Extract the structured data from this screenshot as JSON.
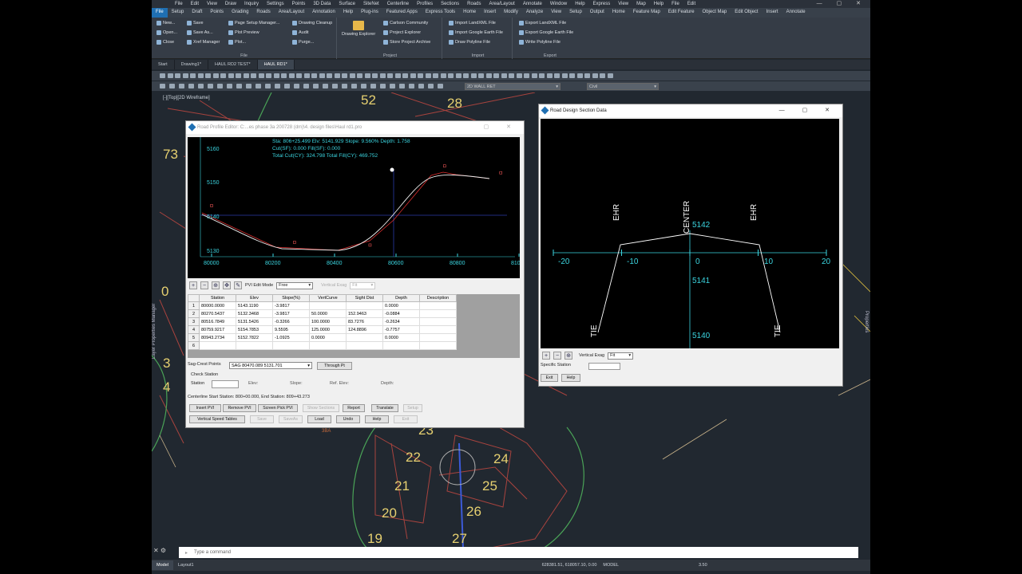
{
  "menu_top": [
    "File",
    "Edit",
    "View",
    "Draw",
    "Inquiry",
    "Settings",
    "Points",
    "3D Data",
    "Surface",
    "SiteNet",
    "Centerline",
    "Profiles",
    "Sections",
    "Roads",
    "Area/Layout",
    "Annotate",
    "Window",
    "Help",
    "Express",
    "View",
    "Map",
    "Help",
    "File",
    "Edit"
  ],
  "menu_tabs": [
    "File",
    "Setup",
    "Draft",
    "Points",
    "Grading",
    "Roads",
    "Area/Layout",
    "Annotation",
    "Help",
    "Plug-ins",
    "Featured Apps",
    "Express Tools",
    "Home",
    "Insert",
    "Modify",
    "Analyze",
    "View",
    "Setup",
    "Output",
    "Home",
    "Feature Map",
    "Edit Feature",
    "Object Map",
    "Edit Object",
    "Insert",
    "Annotate"
  ],
  "ribbon": {
    "file_items": [
      "New...",
      "Open...",
      "Close",
      "Save",
      "Save As...",
      "Xref Manager",
      "Page Setup Manager...",
      "Plot Preview",
      "Plot...",
      "Drawing Cleanup",
      "Audit",
      "Purge..."
    ],
    "file_title": "File",
    "project_items": [
      "Drawing Explorer",
      "Carlson Community",
      "Project Explorer",
      "Store Project Archive"
    ],
    "project_title": "Project",
    "import_items": [
      "Import LandXML File",
      "Import Google Earth File",
      "Draw Polyline File"
    ],
    "import_title": "Import",
    "export_items": [
      "Export LandXML File",
      "Export Google Earth File",
      "Write Polyline File"
    ],
    "export_title": "Export"
  },
  "doc_tabs": [
    "Start",
    "Drawing1*",
    "HAUL RD2 TEST*",
    "HAUL RD1*"
  ],
  "toolbar_fields": {
    "layer": "2D WALL RET",
    "style": "Civil"
  },
  "view_label": "[-][Top][2D Wireframe]",
  "lot_numbers": [
    {
      "n": "52"
    },
    {
      "n": "28"
    },
    {
      "n": "73"
    },
    {
      "n": "0"
    },
    {
      "n": "3"
    },
    {
      "n": "4"
    },
    {
      "n": "23"
    },
    {
      "n": "22"
    },
    {
      "n": "24"
    },
    {
      "n": "21"
    },
    {
      "n": "25"
    },
    {
      "n": "20"
    },
    {
      "n": "26"
    },
    {
      "n": "19"
    },
    {
      "n": "27"
    },
    {
      "n": "E"
    }
  ],
  "small_label": "3BA",
  "profile_editor": {
    "title": "Road Profile Editor: C:...es phase 3a 200728 (dm)\\4. design files\\Haul rd1.pro",
    "info_line1": "Sta: 806+25.499 Elv: 5141.929 Slope: 9.560% Depth: 1.758",
    "info_line2": "Cut(SF): 0.000 Fill(SF): 0.000",
    "info_line3": "Total Cut(CY): 324.798 Total Fill(CY): 469.752",
    "pvi_edit_mode_label": "PVI Edit Mode",
    "pvi_edit_mode": "Free",
    "vert_exag_label": "Vertical Exag",
    "vert_exag": "Fit",
    "columns": [
      "Station",
      "Elev",
      "Slope(%)",
      "VertCurve",
      "Sight Dist",
      "Depth",
      "Description"
    ],
    "rows": [
      {
        "n": "1",
        "station": "80000.0000",
        "elev": "5143.1190",
        "slope": "-3.9817",
        "vc": "",
        "sd": "",
        "depth": "0.0000",
        "desc": ""
      },
      {
        "n": "2",
        "station": "80270.5437",
        "elev": "5132.3468",
        "slope": "-3.9817",
        "vc": "50.0000",
        "sd": "152.9463",
        "depth": "-0.0884",
        "desc": ""
      },
      {
        "n": "3",
        "station": "80516.7849",
        "elev": "5131.5426",
        "slope": "-0.3266",
        "vc": "100.0000",
        "sd": "83.7276",
        "depth": "-0.2634",
        "desc": ""
      },
      {
        "n": "4",
        "station": "80759.9217",
        "elev": "5154.7853",
        "slope": "9.5595",
        "vc": "125.0000",
        "sd": "124.8896",
        "depth": "-0.7757",
        "desc": ""
      },
      {
        "n": "5",
        "station": "80943.2734",
        "elev": "5152.7822",
        "slope": "-1.0925",
        "vc": "0.0000",
        "sd": "",
        "depth": "0.0000",
        "desc": ""
      },
      {
        "n": "6",
        "station": "",
        "elev": "",
        "slope": "",
        "vc": "",
        "sd": "",
        "depth": "",
        "desc": ""
      }
    ],
    "sag_crest_label": "Sag-Crest Points",
    "sag_crest_value": "SAG 80470.089 5131.701",
    "through_pt": "Through Pt",
    "check_station": "Check Station",
    "station_lbl": "Station",
    "elev_lbl": "Elev:",
    "slope_lbl": "Slope:",
    "refelev_lbl": "Ref. Elev:",
    "depth_lbl": "Depth:",
    "centerline_info": "Centerline Start Station: 800+00.000, End Station: 809+43.273",
    "buttons_row1": [
      {
        "label": "Insert PVI",
        "enabled": true
      },
      {
        "label": "Remove PVI",
        "enabled": true
      },
      {
        "label": "Screen Pick PVI",
        "enabled": true
      },
      {
        "label": "Show Sections",
        "enabled": false
      },
      {
        "label": "Report",
        "enabled": true
      },
      {
        "label": "Translate",
        "enabled": true
      },
      {
        "label": "Setup",
        "enabled": false
      }
    ],
    "buttons_row2": [
      {
        "label": "Vertical Speed Tables",
        "enabled": true
      },
      {
        "label": "Save",
        "enabled": false
      },
      {
        "label": "SaveAs",
        "enabled": false
      },
      {
        "label": "Load",
        "enabled": true
      },
      {
        "label": "Undo",
        "enabled": true
      },
      {
        "label": "Help",
        "enabled": true
      },
      {
        "label": "Exit",
        "enabled": false
      }
    ],
    "y_ticks": [
      "5160",
      "5150",
      "5140",
      "5130"
    ],
    "x_ticks": [
      "80000",
      "80200",
      "80400",
      "80600",
      "80800",
      "810"
    ]
  },
  "section_dialog": {
    "title": "Road Design Section Data",
    "x_ticks": [
      "-20",
      "-10",
      "0",
      "10",
      "20"
    ],
    "elev_labels": [
      "5142",
      "5141",
      "5140"
    ],
    "point_labels": [
      "EHR",
      "CENTER",
      "EHR",
      "TIE",
      "TIE"
    ],
    "vert_exag_label": "Vertical Exag",
    "vert_exag": "Fit",
    "specific_station": "Specific Station",
    "exit": "Exit",
    "help": "Help"
  },
  "command_placeholder": "Type a command",
  "status": {
    "coords": "628381.51, 618057.10, 0.00",
    "mode": "MODEL",
    "scale": "3.50",
    "tabs": [
      "Model",
      "Layout1"
    ]
  },
  "side_left": "Layer Properties Manager",
  "side_right": "Properties"
}
